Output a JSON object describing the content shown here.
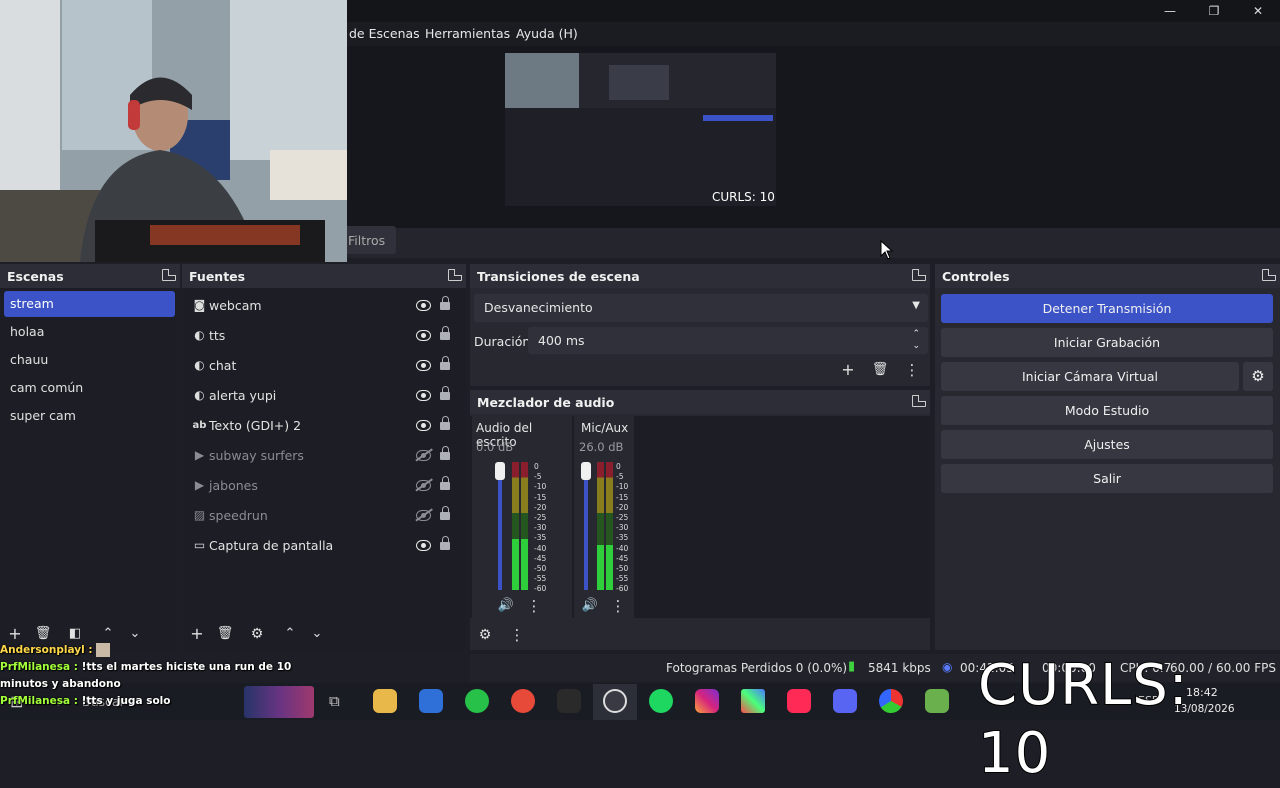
{
  "menu": {
    "items": [
      "de Escenas",
      "Herramientas",
      "Ayuda (H)"
    ]
  },
  "filters_label": "Filtros",
  "preview_overlay": "CURLS: 10",
  "scenes": {
    "title": "Escenas",
    "items": [
      "stream",
      "holaa",
      "chauu",
      "cam común",
      "super cam"
    ],
    "selected": 0
  },
  "sources": {
    "title": "Fuentes",
    "items": [
      {
        "label": "webcam",
        "icon": "camera-icon",
        "visible": true
      },
      {
        "label": "tts",
        "icon": "browser-icon",
        "visible": true
      },
      {
        "label": "chat",
        "icon": "browser-icon",
        "visible": true
      },
      {
        "label": "alerta yupi",
        "icon": "browser-icon",
        "visible": true
      },
      {
        "label": "Texto (GDI+) 2",
        "icon": "text-icon",
        "visible": true
      },
      {
        "label": "subway surfers",
        "icon": "media-icon",
        "visible": false
      },
      {
        "label": "jabones",
        "icon": "media-icon",
        "visible": false
      },
      {
        "label": "speedrun",
        "icon": "image-icon",
        "visible": false
      },
      {
        "label": "Captura de pantalla",
        "icon": "monitor-icon",
        "visible": true
      }
    ]
  },
  "transitions": {
    "title": "Transiciones de escena",
    "selected": "Desvanecimiento",
    "duration_label": "Duración",
    "duration_value": "400 ms"
  },
  "mixer": {
    "title": "Mezclador de audio",
    "channels": [
      {
        "name": "Audio del escrito",
        "db": "0.0 dB",
        "level": 0.6
      },
      {
        "name": "Mic/Aux",
        "db": "26.0 dB",
        "level": 0.35
      }
    ],
    "scale": [
      "0",
      "-5",
      "-10",
      "-15",
      "-20",
      "-25",
      "-30",
      "-35",
      "-40",
      "-45",
      "-50",
      "-55",
      "-60"
    ]
  },
  "controls": {
    "title": "Controles",
    "buttons": [
      "Detener Transmisión",
      "Iniciar Grabación",
      "Iniciar Cámara Virtual",
      "Modo Estudio",
      "Ajustes",
      "Salir"
    ]
  },
  "status": {
    "dropped_frames": "Fotogramas Perdidos 0 (0.0%)",
    "bitrate": "5841 kbps",
    "live_time": "00:42:05",
    "rec_time": "00:00:00",
    "cpu": "CPU: 0.7",
    "fps": "60.00 / 60.00 FPS"
  },
  "chat": [
    {
      "name": "Andersonplayl :",
      "text": "",
      "color": "y"
    },
    {
      "name": "PrfMilanesa :",
      "text": "!tts el martes hiciste una run de 10 minutos y abandono",
      "color": "g"
    },
    {
      "name": "PrfMilanesa :",
      "text": "!tts y juga solo",
      "color": "g"
    }
  ],
  "overlay_counter": "CURLS: 10",
  "taskbar": {
    "search_placeholder": "Buscar",
    "time": "18:42",
    "date": "13/08/2026",
    "lang": "ESP"
  },
  "colors": {
    "accent": "#3b53c6",
    "panel": "#272830",
    "bg": "#1d1e25"
  }
}
